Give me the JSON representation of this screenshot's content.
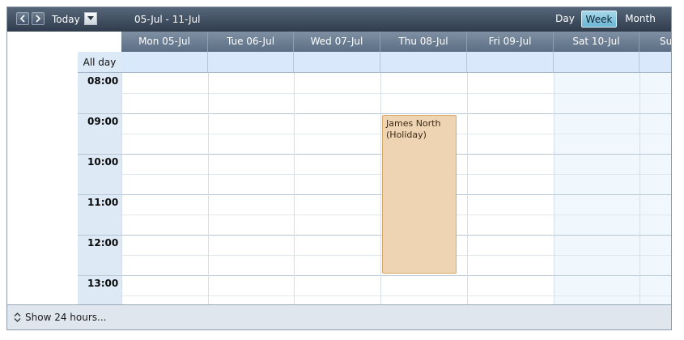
{
  "toolbar": {
    "today_label": "Today",
    "date_range": "05-Jul - 11-Jul",
    "views": [
      {
        "label": "Day",
        "active": false
      },
      {
        "label": "Week",
        "active": true
      },
      {
        "label": "Month",
        "active": false
      }
    ]
  },
  "all_day_label": "All day",
  "days": [
    {
      "label": "Mon 05-Jul"
    },
    {
      "label": "Tue 06-Jul"
    },
    {
      "label": "Wed 07-Jul"
    },
    {
      "label": "Thu 08-Jul"
    },
    {
      "label": "Fri 09-Jul"
    },
    {
      "label": "Sat 10-Jul"
    },
    {
      "label": "Su"
    }
  ],
  "hours": [
    "08:00",
    "09:00",
    "10:00",
    "11:00",
    "12:00",
    "13:00"
  ],
  "appointment": {
    "title": "James North",
    "subtitle": "(Holiday)"
  },
  "footer": {
    "show_hours_label": "Show 24 hours..."
  },
  "colors": {
    "toolbar_top": "#56667a",
    "appointment_fill": "#efd4b3",
    "appointment_border": "#d7a864",
    "active_view": "#6ab6d4"
  }
}
